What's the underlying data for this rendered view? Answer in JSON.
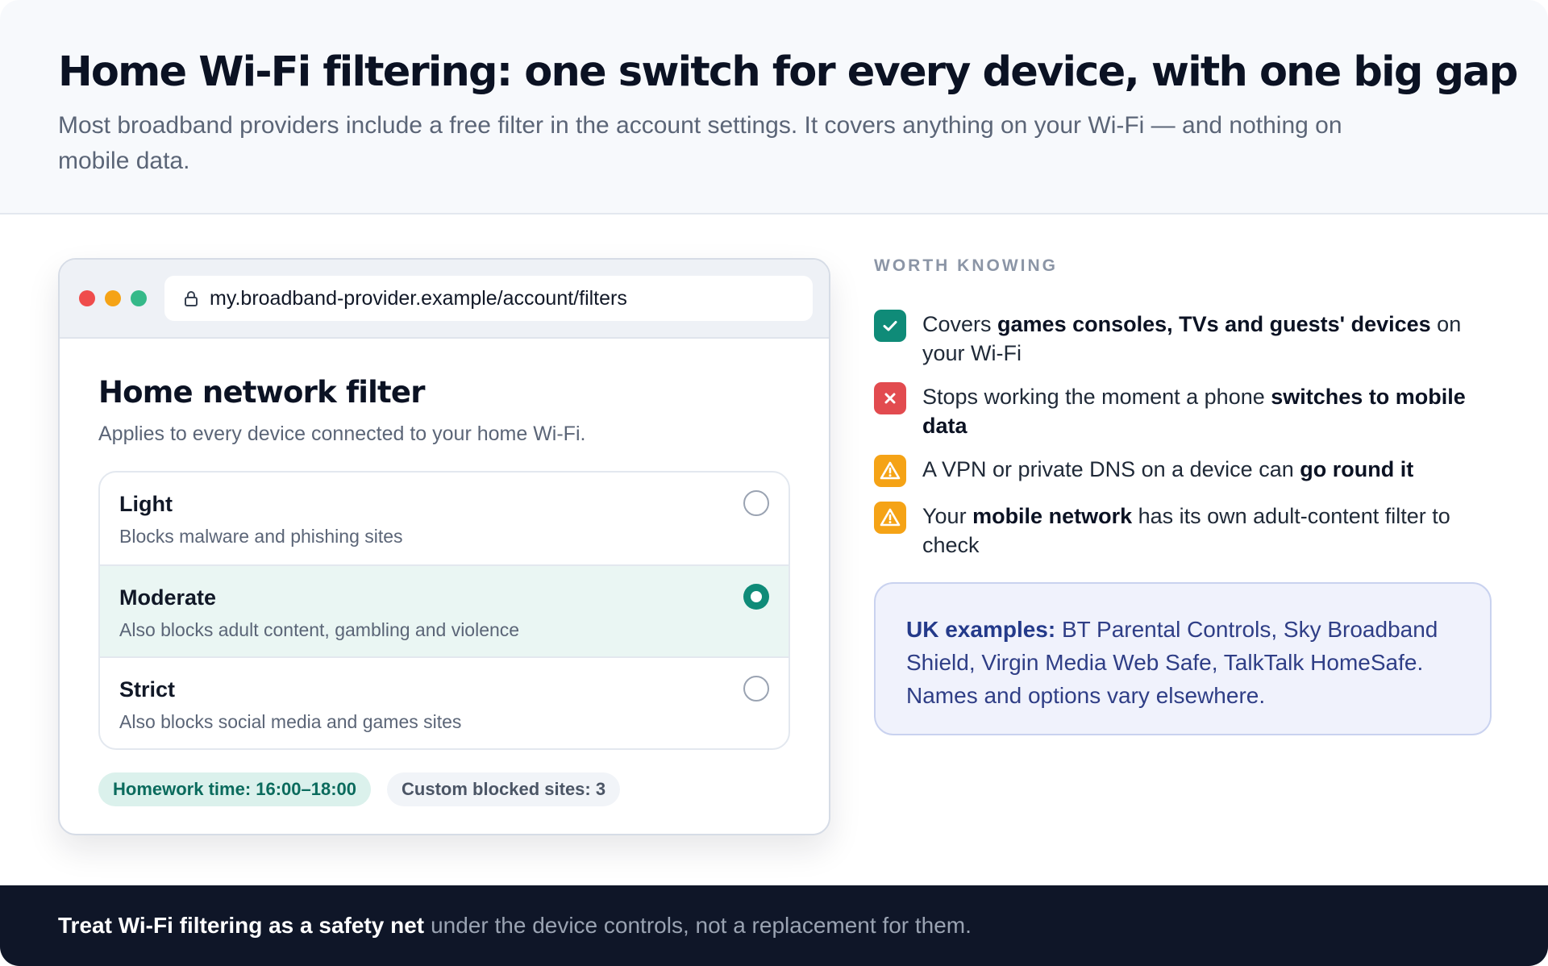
{
  "header": {
    "title": "Home Wi-Fi filtering: one switch for every device, with one big gap",
    "subtitle": "Most broadband providers include a free filter in the account settings. It covers anything on your Wi-Fi — and nothing on mobile data."
  },
  "browser": {
    "url": "my.broadband-provider.example/account/filters",
    "panel_title": "Home network filter",
    "panel_subtitle": "Applies to every device connected to your home Wi-Fi.",
    "options": [
      {
        "name": "Light",
        "desc": "Blocks malware and phishing sites",
        "selected": false
      },
      {
        "name": "Moderate",
        "desc": "Also blocks adult content, gambling and violence",
        "selected": true
      },
      {
        "name": "Strict",
        "desc": "Also blocks social media and games sites",
        "selected": false
      }
    ],
    "chips": {
      "homework": "Homework time: 16:00–18:00",
      "custom": "Custom blocked sites: 3"
    }
  },
  "side": {
    "eyebrow": "WORTH KNOWING",
    "facts": [
      {
        "icon": "check-icon",
        "pre": "Covers ",
        "bold": "games consoles, TVs and guests' devices",
        "post": " on your Wi-Fi"
      },
      {
        "icon": "cross-icon",
        "pre": "Stops working the moment a phone ",
        "bold": "switches to mobile data",
        "post": ""
      },
      {
        "icon": "warning-icon",
        "pre": "A VPN or private DNS on a device can ",
        "bold": "go round it",
        "post": ""
      },
      {
        "icon": "warning-icon",
        "pre": "Your ",
        "bold": "mobile network",
        "post": " has its own adult-content filter to check"
      }
    ],
    "examples_lead": "UK examples:",
    "examples_text": " BT Parental Controls, Sky Broadband Shield, Virgin Media Web Safe, TalkTalk HomeSafe. Names and options vary elsewhere."
  },
  "footer": {
    "strong": "Treat Wi-Fi filtering as a safety net",
    "rest": "under the device controls, not a replacement for them."
  },
  "colors": {
    "accent_teal": "#0f8b78",
    "danger_red": "#e24b4f",
    "warning_amber": "#f5a316",
    "footer_bg": "#0f1628"
  }
}
